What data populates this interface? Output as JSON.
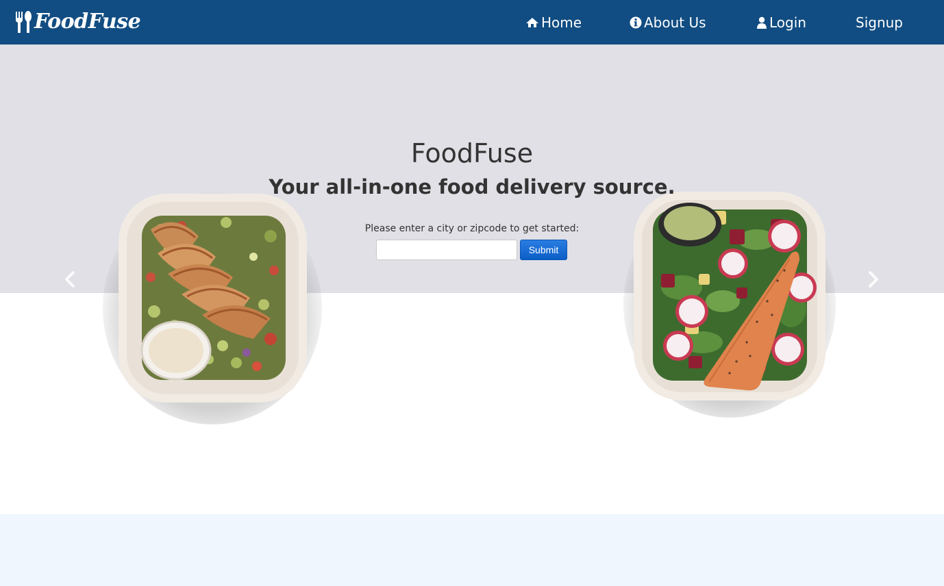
{
  "navbar": {
    "brand": "FoodFuse",
    "brand_icon": "fork-spoon-icon",
    "bg_color": "#114d82",
    "items": [
      {
        "label": "Home",
        "icon": "home-icon"
      },
      {
        "label": "About Us",
        "icon": "info-icon"
      },
      {
        "label": "Login",
        "icon": "user-icon"
      },
      {
        "label": "Signup",
        "icon": ""
      }
    ]
  },
  "hero": {
    "title": "FoodFuse",
    "subtitle": "Your all-in-one food delivery source.",
    "prompt": "Please enter a city or zipcode to get started:",
    "input_value": "",
    "input_placeholder": "",
    "submit_label": "Submit",
    "band_color": "#e0e0e6",
    "carousel": {
      "prev_icon": "chevron-left-icon",
      "next_icon": "chevron-right-icon",
      "images": [
        "grilled-chicken-bowl",
        "salmon-salad-bowl"
      ]
    }
  },
  "footer": {
    "bg_color": "#f0f6fe"
  }
}
